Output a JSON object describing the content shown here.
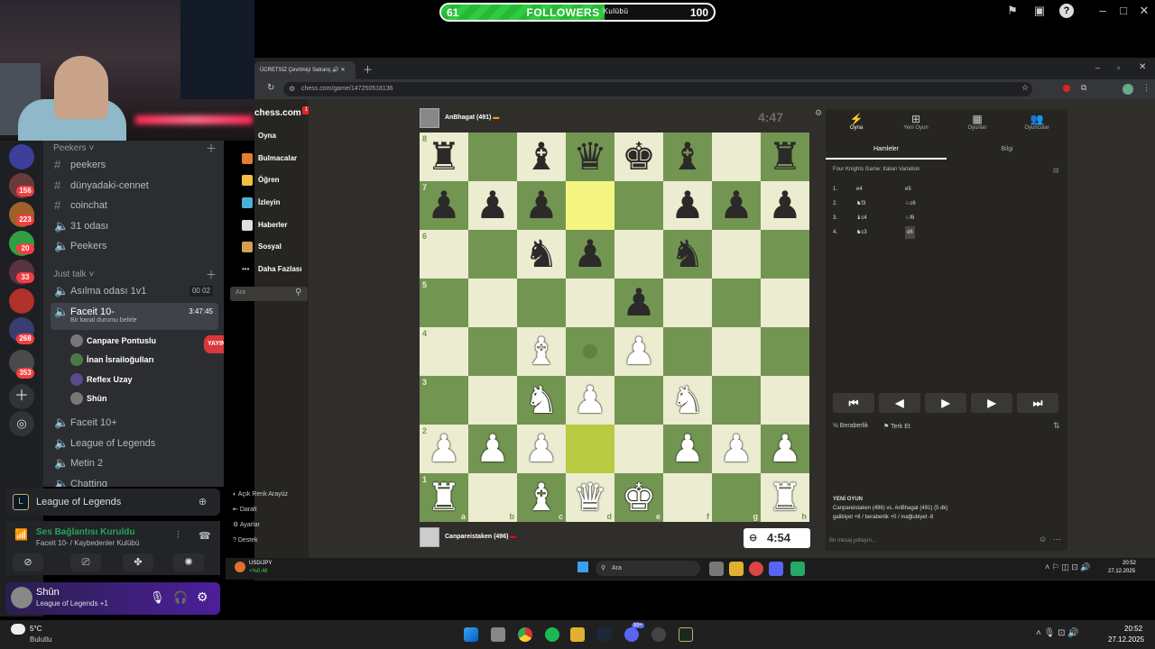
{
  "followers": {
    "current": "61",
    "label": "FOLLOWERS",
    "overlay": "Kulübü",
    "target": "100",
    "progress": 0.6
  },
  "discord": {
    "category1": "Peekers",
    "channels1": [
      "peekers",
      "dünyadaki-cennet",
      "coinchat",
      "31 odası",
      "Peekers"
    ],
    "category2": "Just talk",
    "voice": [
      {
        "name": "Asılma odası 1v1",
        "meta": "00  02"
      },
      {
        "name": "Faceit 10-",
        "meta": "3:47:45",
        "sub": "Bir kanal durumu belirle"
      },
      {
        "name": "Faceit 10+"
      },
      {
        "name": "League of Legends"
      },
      {
        "name": "Metin 2"
      },
      {
        "name": "Chatting"
      }
    ],
    "voice_users": [
      {
        "name": "Canpare Pontuslu",
        "live": "YAYINDA"
      },
      {
        "name": "İnan İsrailoğulları"
      },
      {
        "name": "Reflex Uzay"
      },
      {
        "name": "Shûn"
      }
    ],
    "server_badges": [
      "156",
      "223",
      "20",
      "33",
      "268",
      "353"
    ],
    "activity": "League of Legends",
    "voice_status": "Ses Bağlantısı Kuruldu",
    "voice_location": "Faceit 10- / Kaybedenler Kulübü",
    "username": "Shûn",
    "user_status": "League of Legends +1"
  },
  "browser": {
    "tab_title": "ÜCRETSİZ Çevrimiçi Satranç",
    "url": "chess.com/game/147250518136"
  },
  "chess": {
    "logo": "chess.com",
    "logo_badge": "1",
    "nav": [
      "Oyna",
      "Bulmacalar",
      "Öğren",
      "İzleyin",
      "Haberler",
      "Sosyal",
      "Daha Fazlası"
    ],
    "search_placeholder": "Ara",
    "bottom_nav": [
      "Açık Renk Arayüz",
      "Daralt",
      "Ayarlar",
      "Destek"
    ],
    "top_player": "AnBhagat (491)",
    "top_clock": "4:47",
    "bottom_player": "Canpareistaken (496)",
    "bottom_clock": "4:54",
    "ranks": [
      "8",
      "7",
      "6",
      "5",
      "4",
      "3",
      "2",
      "1"
    ],
    "files": [
      "a",
      "b",
      "c",
      "d",
      "e",
      "f",
      "g",
      "h"
    ],
    "board": [
      [
        "bR",
        "",
        "bB",
        "bQ",
        "bK",
        "bB",
        "",
        "bR"
      ],
      [
        "bP",
        "bP",
        "bP",
        "",
        "",
        "bP",
        "bP",
        "bP"
      ],
      [
        "",
        "",
        "bN",
        "bP",
        "",
        "bN",
        "",
        ""
      ],
      [
        "",
        "",
        "",
        "",
        "bP",
        "",
        "",
        ""
      ],
      [
        "",
        "",
        "wB",
        "",
        "wP",
        "",
        "",
        ""
      ],
      [
        "",
        "",
        "wN",
        "wP",
        "",
        "wN",
        "",
        ""
      ],
      [
        "wP",
        "wP",
        "wP",
        "",
        "",
        "wP",
        "wP",
        "wP"
      ],
      [
        "wR",
        "",
        "wB",
        "wQ",
        "wK",
        "",
        "",
        "wR"
      ]
    ],
    "panel_tabs": [
      "Oyna",
      "Yeni Oyun",
      "Oyunlar",
      "Oyuncular"
    ],
    "sub_tabs": [
      "Hamleler",
      "Bilgi"
    ],
    "opening": "Four Knights Game: Italian Variation",
    "moves": [
      {
        "n": "1.",
        "w": "e4",
        "b": "e5"
      },
      {
        "n": "2.",
        "w": "♞f3",
        "b": "♘c6"
      },
      {
        "n": "3.",
        "w": "♝c4",
        "b": "♘f6"
      },
      {
        "n": "4.",
        "w": "♞c3",
        "b": "d6"
      }
    ],
    "move_buttons": [
      "⏮",
      "◀",
      "▶",
      "▶",
      "⏭"
    ],
    "draw": "Beraberlik",
    "resign": "Terk Et",
    "new_game_title": "YENİ OYUN",
    "new_game_text": "Canpareistaken (496) vs. AnBhagat (491) (5 dk)",
    "new_game_stats": "galibiyet +8 / beraberlik +0 / mağlubiyet -8",
    "chat_placeholder": "Bir mesaj yollayın..."
  },
  "taskbar": {
    "currency": "USD/JPY",
    "currency_change": "+%0,48",
    "search": "Ara",
    "inner_time": "20:52",
    "inner_date": "27.12.2025",
    "weather": "5°C",
    "weather_desc": "Bulutlu",
    "time": "20:52",
    "date": "27.12.2025",
    "notif": "99+"
  }
}
